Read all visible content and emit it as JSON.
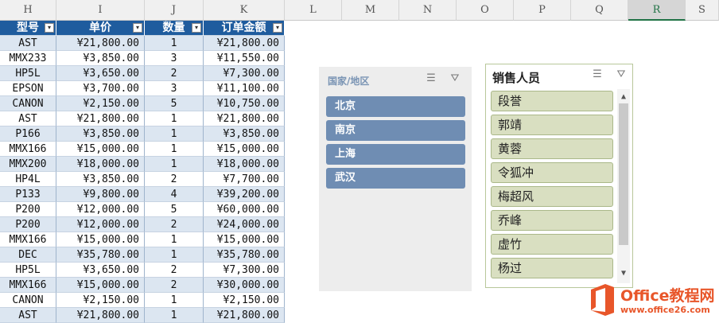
{
  "columns": [
    "H",
    "I",
    "J",
    "K",
    "L",
    "M",
    "N",
    "O",
    "P",
    "Q",
    "R",
    "S"
  ],
  "selected_column": "R",
  "table": {
    "headers": [
      "型号",
      "单价",
      "数量",
      "订单金额"
    ],
    "rows": [
      [
        "AST",
        "¥21,800.00",
        "1",
        "¥21,800.00"
      ],
      [
        "MMX233",
        "¥3,850.00",
        "3",
        "¥11,550.00"
      ],
      [
        "HP5L",
        "¥3,650.00",
        "2",
        "¥7,300.00"
      ],
      [
        "EPSON",
        "¥3,700.00",
        "3",
        "¥11,100.00"
      ],
      [
        "CANON",
        "¥2,150.00",
        "5",
        "¥10,750.00"
      ],
      [
        "AST",
        "¥21,800.00",
        "1",
        "¥21,800.00"
      ],
      [
        "P166",
        "¥3,850.00",
        "1",
        "¥3,850.00"
      ],
      [
        "MMX166",
        "¥15,000.00",
        "1",
        "¥15,000.00"
      ],
      [
        "MMX200",
        "¥18,000.00",
        "1",
        "¥18,000.00"
      ],
      [
        "HP4L",
        "¥3,850.00",
        "2",
        "¥7,700.00"
      ],
      [
        "P133",
        "¥9,800.00",
        "4",
        "¥39,200.00"
      ],
      [
        "P200",
        "¥12,000.00",
        "5",
        "¥60,000.00"
      ],
      [
        "P200",
        "¥12,000.00",
        "2",
        "¥24,000.00"
      ],
      [
        "MMX166",
        "¥15,000.00",
        "1",
        "¥15,000.00"
      ],
      [
        "DEC",
        "¥35,780.00",
        "1",
        "¥35,780.00"
      ],
      [
        "HP5L",
        "¥3,650.00",
        "2",
        "¥7,300.00"
      ],
      [
        "MMX166",
        "¥15,000.00",
        "2",
        "¥30,000.00"
      ],
      [
        "CANON",
        "¥2,150.00",
        "1",
        "¥2,150.00"
      ],
      [
        "AST",
        "¥21,800.00",
        "1",
        "¥21,800.00"
      ]
    ]
  },
  "slicer_region": {
    "title": "国家/地区",
    "items": [
      "北京",
      "南京",
      "上海",
      "武汉"
    ],
    "multiselect_icon": "multi-select-icon",
    "clear_filter_icon": "clear-filter-icon"
  },
  "slicer_salesperson": {
    "title": "销售人员",
    "items": [
      "段誉",
      "郭靖",
      "黄蓉",
      "令狐冲",
      "梅超风",
      "乔峰",
      "虚竹",
      "杨过"
    ],
    "multiselect_icon": "multi-select-icon",
    "clear_filter_icon": "clear-filter-icon"
  },
  "logo": {
    "name": "Office教程网",
    "url": "www.office26.com"
  },
  "colors": {
    "header_blue": "#1f5c9e",
    "band_blue": "#dce6f1",
    "slicer_item_blue": "#6f8db3",
    "slicer_item_green": "#d9dfc1",
    "logo_orange": "#e8562a"
  }
}
